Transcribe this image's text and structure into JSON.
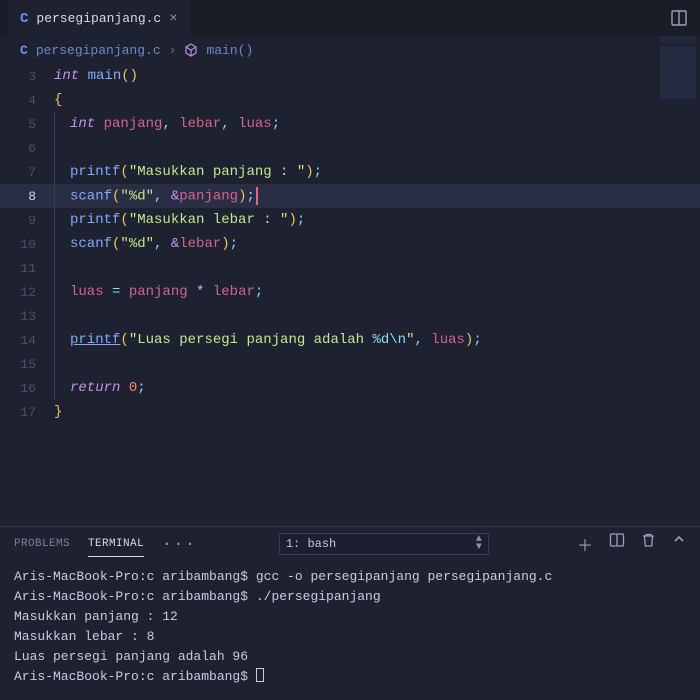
{
  "tab": {
    "icon": "C",
    "filename": "persegipanjang.c"
  },
  "breadcrumb": {
    "icon": "C",
    "file": "persegipanjang.c",
    "func": "main()"
  },
  "code": {
    "l3": {
      "kw": "int",
      "fn": "main"
    },
    "l5": {
      "typ": "int",
      "v1": "panjang",
      "v2": "lebar",
      "v3": "luas"
    },
    "l7": {
      "fn": "printf",
      "str": "\"Masukkan panjang : \""
    },
    "l8": {
      "fn": "scanf",
      "fmt": "\"%d\"",
      "var": "panjang"
    },
    "l9": {
      "fn": "printf",
      "str": "\"Masukkan lebar : \""
    },
    "l10": {
      "fn": "scanf",
      "fmt": "\"%d\"",
      "var": "lebar"
    },
    "l12": {
      "a": "luas",
      "b": "panjang",
      "c": "lebar"
    },
    "l14": {
      "fn": "printf",
      "s1": "\"Luas persegi panjang adalah ",
      "esc": "%d\\n",
      "s2": "\"",
      "var": "luas"
    },
    "l16": {
      "kw": "return",
      "num": "0"
    }
  },
  "gutters": [
    "3",
    "4",
    "5",
    "6",
    "7",
    "8",
    "9",
    "10",
    "11",
    "12",
    "13",
    "14",
    "15",
    "16",
    "17"
  ],
  "panel": {
    "tabs": {
      "problems": "PROBLEMS",
      "terminal": "TERMINAL"
    },
    "selector": "1: bash"
  },
  "terminal": {
    "l1": "Aris-MacBook-Pro:c aribambang$ gcc -o persegipanjang persegipanjang.c",
    "l2": "Aris-MacBook-Pro:c aribambang$ ./persegipanjang",
    "l3": "Masukkan panjang : 12",
    "l4": "Masukkan lebar : 8",
    "l5": "Luas persegi panjang adalah 96",
    "l6": "Aris-MacBook-Pro:c aribambang$ "
  }
}
